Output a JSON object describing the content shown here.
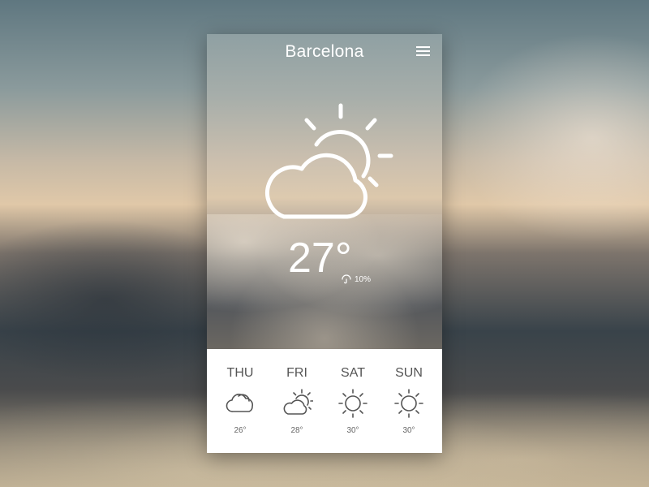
{
  "app": {
    "city": "Barcelona",
    "current": {
      "temperature": "27°",
      "condition_icon": "cloud-sun-icon",
      "humidity": "10%"
    },
    "menu_icon": "hamburger-menu-icon"
  },
  "forecast": [
    {
      "day": "THU",
      "temp": "26°",
      "icon": "cloud-icon"
    },
    {
      "day": "FRI",
      "temp": "28°",
      "icon": "cloud-sun-icon"
    },
    {
      "day": "SAT",
      "temp": "30°",
      "icon": "sun-icon"
    },
    {
      "day": "SUN",
      "temp": "30°",
      "icon": "sun-icon"
    }
  ],
  "colors": {
    "icon_white": "#ffffff",
    "forecast_text": "#555555",
    "forecast_bg": "#ffffff"
  }
}
